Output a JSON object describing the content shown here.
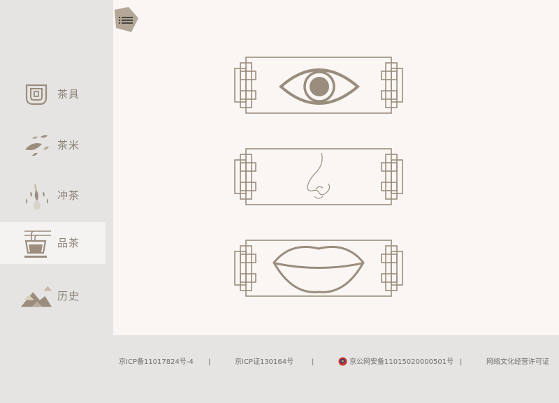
{
  "sidebar": {
    "items": [
      {
        "label": "茶具",
        "icon": "tea-set-icon",
        "active": false
      },
      {
        "label": "茶米",
        "icon": "tea-leaves-icon",
        "active": false
      },
      {
        "label": "冲茶",
        "icon": "brewing-icon",
        "active": false
      },
      {
        "label": "品茶",
        "icon": "tea-cup-icon",
        "active": true
      },
      {
        "label": "历史",
        "icon": "mountains-icon",
        "active": false
      }
    ],
    "menu_icon": "list-menu-icon"
  },
  "main": {
    "cards": [
      {
        "icon": "eye-icon"
      },
      {
        "icon": "nose-icon"
      },
      {
        "icon": "lips-icon"
      }
    ]
  },
  "footer": {
    "icp_filing": "京ICP备11017824号-4",
    "icp_license": "京ICP证130164号",
    "police_filing": "京公网安备11015020000501号",
    "culture_license": "网络文化经营许可证",
    "separator": "|"
  },
  "colors": {
    "accent": "#9a8d7d",
    "sidebar_bg": "#e5e4e2",
    "main_bg": "#f9f6f4",
    "active_bg": "#f4f3f1",
    "label": "#8c8377"
  }
}
